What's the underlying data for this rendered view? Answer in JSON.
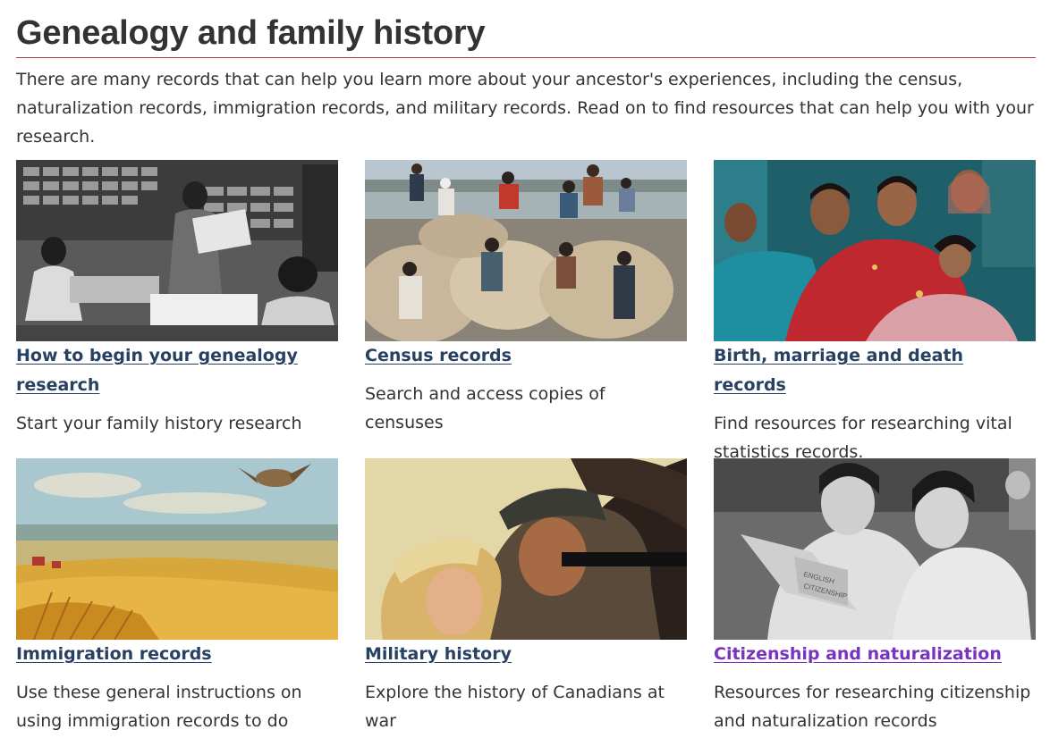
{
  "page": {
    "title": "Genealogy and family history",
    "intro": "There are many records that can help you learn more about your ancestor's experiences, including the census, naturalization records, immigration records, and military records. Read on to find resources that can help you with your research."
  },
  "cards": [
    {
      "title": "How to begin your genealogy research",
      "description": "Start your family history research",
      "image": "archive-workers-photo"
    },
    {
      "title": "Census records",
      "description": "Search and access copies of censuses",
      "image": "children-on-bales-photo"
    },
    {
      "title": "Birth, marriage and death records",
      "description": "Find resources for researching vital statistics records.",
      "image": "wedding-women-photo"
    },
    {
      "title": "Immigration records",
      "description": "Use these general instructions on using immigration records to do",
      "image": "prairie-painting"
    },
    {
      "title": "Military history",
      "description": "Explore the history of Canadians at war",
      "image": "war-poster"
    },
    {
      "title": "Citizenship and naturalization",
      "description": "Resources for researching citizenship and naturalization records",
      "image": "citizenship-book-photo"
    }
  ],
  "colors": {
    "link": "#284162",
    "visited_link": "#7834bc",
    "rule": "#af3c43",
    "text": "#333333"
  }
}
